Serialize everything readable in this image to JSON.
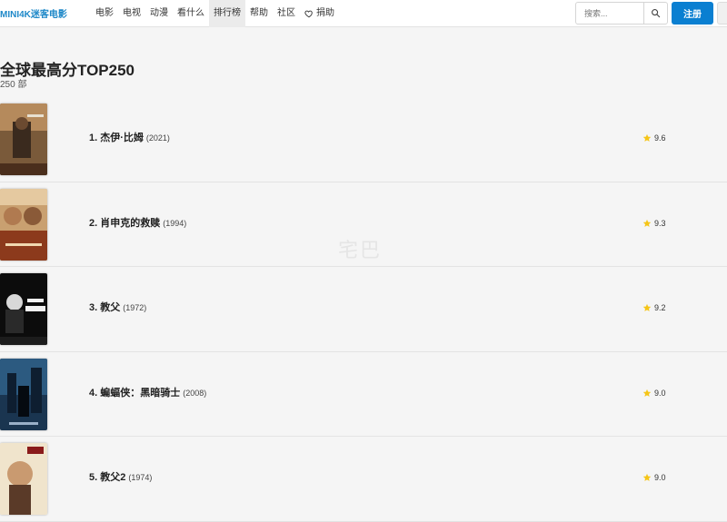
{
  "brand": "MINI4K迷客电影",
  "nav": {
    "items": [
      {
        "label": "电影",
        "active": false
      },
      {
        "label": "电视",
        "active": false
      },
      {
        "label": "动漫",
        "active": false
      },
      {
        "label": "看什么",
        "active": false
      },
      {
        "label": "排行榜",
        "active": true
      },
      {
        "label": "帮助",
        "active": false
      },
      {
        "label": "社区",
        "active": false
      }
    ],
    "donate_label": "捐助"
  },
  "search": {
    "placeholder": "搜索..."
  },
  "register_label": "注册",
  "page": {
    "title": "全球最高分TOP250",
    "count": "250 部"
  },
  "movies": [
    {
      "title": "1. 杰伊·比姆",
      "year": "(2021)",
      "rating": "9.6"
    },
    {
      "title": "2. 肖申克的救赎",
      "year": "(1994)",
      "rating": "9.3"
    },
    {
      "title": "3. 教父",
      "year": "(1972)",
      "rating": "9.2"
    },
    {
      "title": "4. 蝙蝠侠：黑暗骑士",
      "year": "(2008)",
      "rating": "9.0"
    },
    {
      "title": "5. 教父2",
      "year": "(1974)",
      "rating": "9.0"
    }
  ],
  "colors": {
    "accent": "#0a7fd1",
    "brand": "#1e88c8",
    "star": "#f5c518"
  },
  "icons": {
    "search": "search-icon",
    "donate": "heart-icon",
    "rating": "star-icon"
  }
}
